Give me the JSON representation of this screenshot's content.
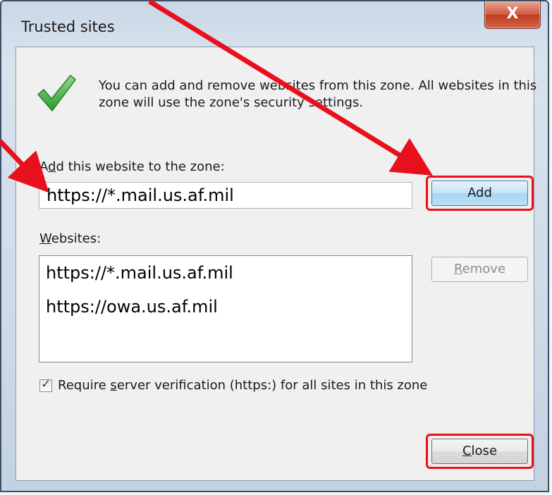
{
  "window": {
    "title": "Trusted sites",
    "close_glyph": "X"
  },
  "description": "You can add and remove websites from this zone. All websites in this zone will use the zone's security settings.",
  "add_section": {
    "label_pre": "A",
    "label_underline": "d",
    "label_post": "d this website to the zone:",
    "input_value": "https://*.mail.us.af.mil",
    "add_label": "Add"
  },
  "websites": {
    "label_underline": "W",
    "label_post": "ebsites:",
    "items": [
      "https://*.mail.us.af.mil",
      "https://owa.us.af.mil"
    ],
    "remove_underline": "R",
    "remove_post": "emove"
  },
  "verification": {
    "checked": true,
    "label_pre": "Require ",
    "label_underline": "s",
    "label_post": "erver verification (https:) for all sites in this zone"
  },
  "close_button": {
    "underline": "C",
    "post": "lose"
  },
  "colors": {
    "annotation": "#e8101d",
    "check_green": "#3aa63a"
  }
}
